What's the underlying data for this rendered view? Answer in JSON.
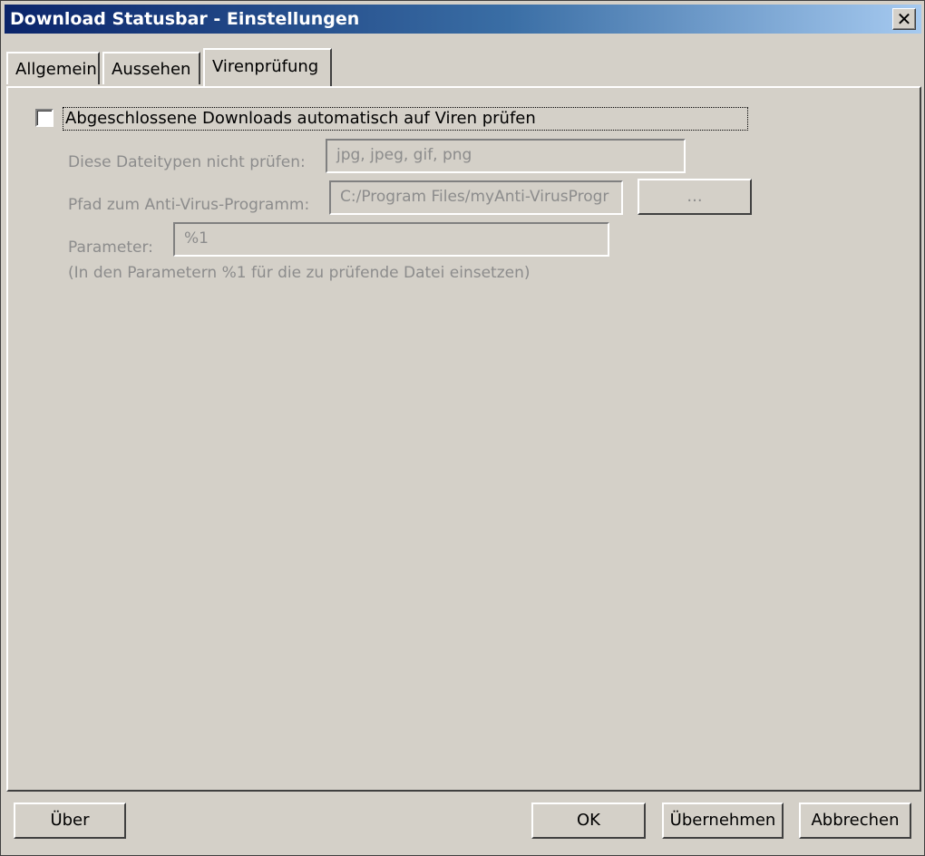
{
  "window": {
    "title": "Download Statusbar - Einstellungen",
    "close_glyph": "✕"
  },
  "tabs": [
    {
      "label": "Allgemein"
    },
    {
      "label": "Aussehen"
    },
    {
      "label": "Virenprüfung"
    }
  ],
  "active_tab": "Virenprüfung",
  "virus": {
    "auto_scan_label": "Abgeschlossene Downloads automatisch auf Viren prüfen",
    "auto_scan_checked": false,
    "exclude_label": "Diese Dateitypen nicht prüfen:",
    "exclude_value": "jpg, jpeg, gif, png",
    "path_label": "Pfad zum Anti-Virus-Programm:",
    "path_value": "C:/Program Files/myAnti-VirusProgr",
    "browse_label": "...",
    "param_label": "Parameter:",
    "param_value": "%1",
    "param_hint": "(In den Parametern %1 für die zu prüfende Datei einsetzen)"
  },
  "footer": {
    "about_label": "Über",
    "ok_label": "OK",
    "apply_label": "Übernehmen",
    "cancel_label": "Abbrechen"
  }
}
